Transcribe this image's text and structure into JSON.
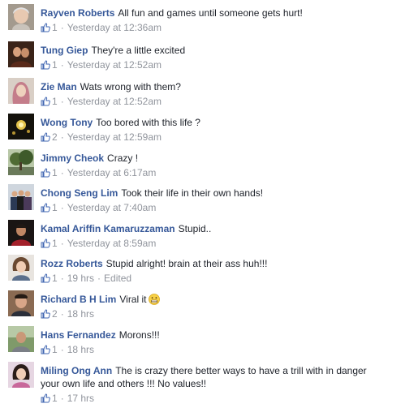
{
  "comments": [
    {
      "author": "Rayven Roberts",
      "text": "All fun and games until someone gets hurt!",
      "likes": "1",
      "time": "Yesterday at 12:36am",
      "avatar_icon": "woman-avatar-icon",
      "line2": ""
    },
    {
      "author": "Tung Giep",
      "text": "They're a little excited",
      "likes": "1",
      "time": "Yesterday at 12:52am",
      "avatar_icon": "couple-avatar-icon",
      "line2": ""
    },
    {
      "author": "Zie Man",
      "text": "Wats wrong with them?",
      "likes": "1",
      "time": "Yesterday at 12:52am",
      "avatar_icon": "hijab-woman-avatar-icon",
      "line2": ""
    },
    {
      "author": "Wong Tony",
      "text": "Too bored with this life ?",
      "likes": "2",
      "time": "Yesterday at 12:59am",
      "avatar_icon": "night-lights-avatar-icon",
      "line2": ""
    },
    {
      "author": "Jimmy Cheok",
      "text": "Crazy !",
      "likes": "1",
      "time": "Yesterday at 6:17am",
      "avatar_icon": "tree-avatar-icon",
      "line2": ""
    },
    {
      "author": "Chong Seng Lim",
      "text": "Took their life in their own hands!",
      "likes": "1",
      "time": "Yesterday at 7:40am",
      "avatar_icon": "group-photo-avatar-icon",
      "line2": ""
    },
    {
      "author": "Kamal Ariffin Kamaruzzaman",
      "text": "Stupid..",
      "likes": "1",
      "time": "Yesterday at 8:59am",
      "avatar_icon": "man-red-avatar-icon",
      "line2": ""
    },
    {
      "author": "Rozz Roberts",
      "text": "Stupid alright! brain at their ass huh!!!",
      "likes": "1",
      "time": "19 hrs",
      "edited": "Edited",
      "avatar_icon": "woman-light-avatar-icon",
      "line2": ""
    },
    {
      "author": "Richard B H Lim",
      "text": "Viral it",
      "likes": "2",
      "time": "18 hrs",
      "emoji": "grimace-emoji-icon",
      "avatar_icon": "man-avatar-icon",
      "line2": ""
    },
    {
      "author": "Hans Fernandez",
      "text": "Morons!!!",
      "likes": "1",
      "time": "18 hrs",
      "avatar_icon": "man-outdoor-avatar-icon",
      "line2": ""
    },
    {
      "author": "Miling Ong Ann",
      "text": "The is crazy there better ways to have a trill with in danger",
      "line2": "your own life and others !!! No values!!",
      "likes": "1",
      "time": "17 hrs",
      "avatar_icon": "woman-pink-avatar-icon"
    }
  ],
  "colors": {
    "author": "#365899",
    "text": "#1d2129",
    "meta": "#90949c",
    "like_icon": "#4267b2"
  }
}
